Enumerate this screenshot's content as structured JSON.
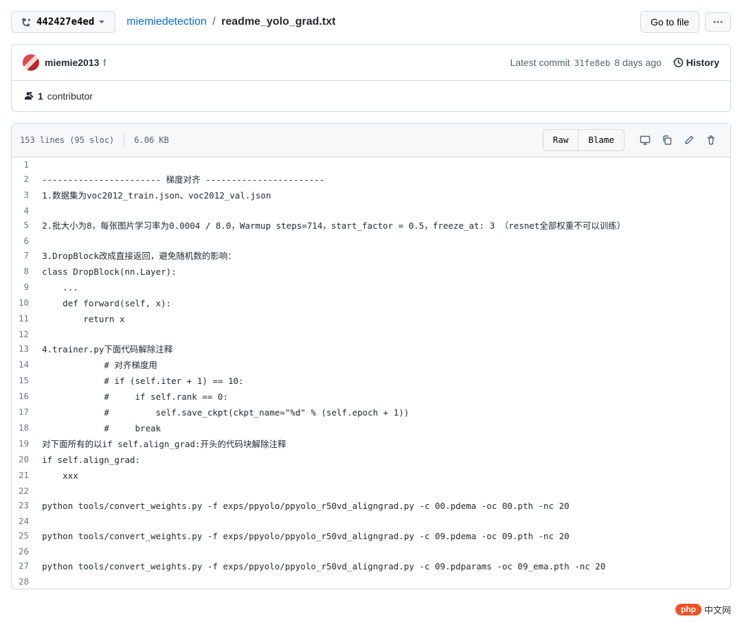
{
  "branch": {
    "label": "442427e4ed"
  },
  "breadcrumb": {
    "repo": "miemiedetection",
    "file": "readme_yolo_grad.txt"
  },
  "topButtons": {
    "goToFile": "Go to file"
  },
  "commit": {
    "author": "miemie2013",
    "message": "f",
    "latestLabel": "Latest commit",
    "sha": "31fe8eb",
    "age": "8 days ago",
    "historyLabel": "History"
  },
  "contrib": {
    "count": "1",
    "label": "contributor"
  },
  "codeMeta": {
    "lines": "153 lines (95 sloc)",
    "size": "6.06 KB",
    "raw": "Raw",
    "blame": "Blame"
  },
  "code": [
    "",
    "----------------------- 梯度对齐 -----------------------",
    "1.数据集为voc2012_train.json、voc2012_val.json",
    "",
    "2.批大小为8，每张图片学习率为0.0004 / 8.0，Warmup steps=714，start_factor = 0.5，freeze_at: 3 （resnet全部权重不可以训练）",
    "",
    "3.DropBlock改成直接返回，避免随机数的影响：",
    "class DropBlock(nn.Layer):",
    "    ...",
    "    def forward(self, x):",
    "        return x",
    "",
    "4.trainer.py下面代码解除注释",
    "            # 对齐梯度用",
    "            # if (self.iter + 1) == 10:",
    "            #     if self.rank == 0:",
    "            #         self.save_ckpt(ckpt_name=\"%d\" % (self.epoch + 1))",
    "            #     break",
    "对下面所有的以if self.align_grad:开头的代码块解除注释",
    "if self.align_grad:",
    "    xxx",
    "",
    "python tools/convert_weights.py -f exps/ppyolo/ppyolo_r50vd_aligngrad.py -c 00.pdema -oc 00.pth -nc 20",
    "",
    "python tools/convert_weights.py -f exps/ppyolo/ppyolo_r50vd_aligngrad.py -c 09.pdema -oc 09.pth -nc 20",
    "",
    "python tools/convert_weights.py -f exps/ppyolo/ppyolo_r50vd_aligngrad.py -c 09.pdparams -oc 09_ema.pth -nc 20",
    ""
  ],
  "watermark": {
    "badge": "php",
    "text": "中文网"
  }
}
